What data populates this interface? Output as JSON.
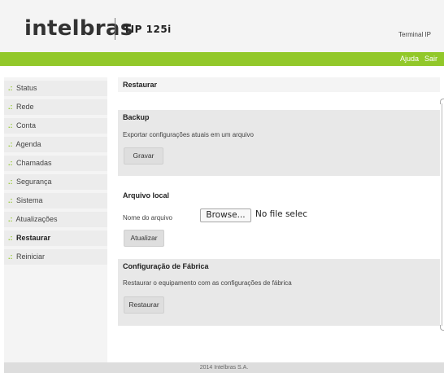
{
  "header": {
    "brand": "intelbras",
    "product": "TIP 125i",
    "terminal_label": "Terminal IP"
  },
  "topnav": {
    "help": "Ajuda",
    "logout": "Sair"
  },
  "sidebar": {
    "prefix": ".:",
    "items": [
      {
        "label": "Status"
      },
      {
        "label": "Rede"
      },
      {
        "label": "Conta"
      },
      {
        "label": "Agenda"
      },
      {
        "label": "Chamadas"
      },
      {
        "label": "Segurança"
      },
      {
        "label": "Sistema"
      },
      {
        "label": "Atualizações"
      },
      {
        "label": "Restaurar"
      },
      {
        "label": "Reiniciar"
      }
    ],
    "active": "Restaurar"
  },
  "main": {
    "title": "Restaurar",
    "backup": {
      "title": "Backup",
      "description": "Exportar configurações atuais em um arquivo",
      "button": "Gravar"
    },
    "local_file": {
      "title": "Arquivo local",
      "field_label": "Nome do arquivo",
      "browse_button": "Browse...",
      "file_status": "No file selec",
      "button": "Atualizar"
    },
    "factory": {
      "title": "Configuração de Fábrica",
      "description": "Restaurar o equipamento com as configurações de fábrica",
      "button": "Restaurar"
    }
  },
  "footer": {
    "text": "2014 Intelbras S.A."
  },
  "colors": {
    "accent_green": "#92c82a",
    "panel_gray": "#e8e8e8"
  }
}
